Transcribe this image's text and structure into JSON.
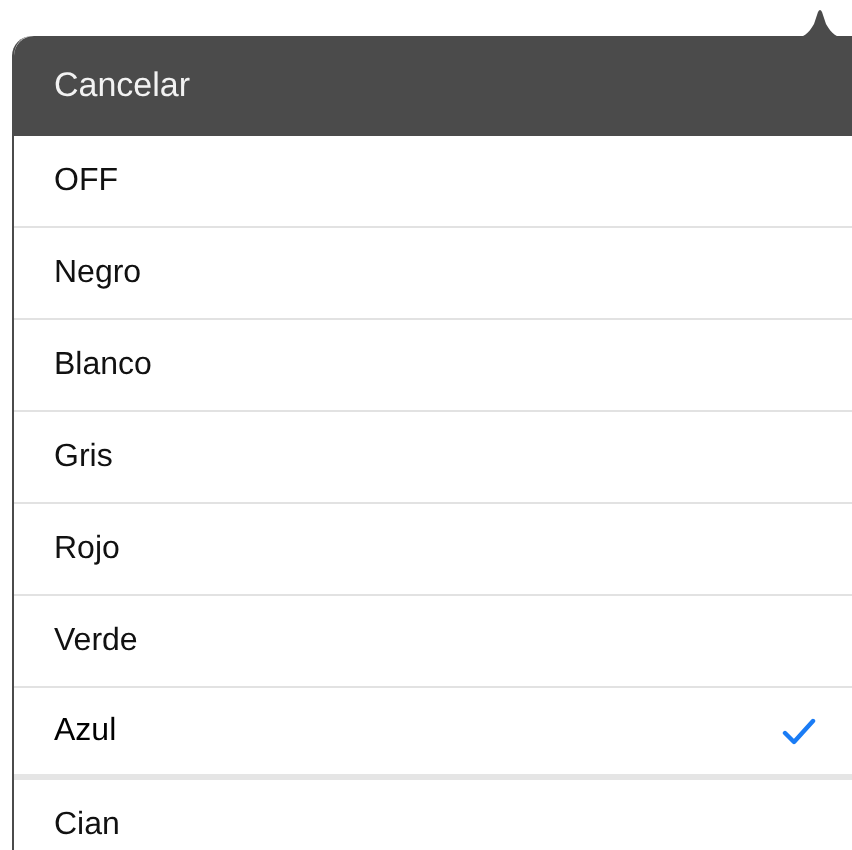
{
  "header": {
    "cancel": "Cancelar"
  },
  "options": [
    {
      "label": "OFF",
      "selected": false
    },
    {
      "label": "Negro",
      "selected": false
    },
    {
      "label": "Blanco",
      "selected": false
    },
    {
      "label": "Gris",
      "selected": false
    },
    {
      "label": "Rojo",
      "selected": false
    },
    {
      "label": "Verde",
      "selected": false
    },
    {
      "label": "Azul",
      "selected": true
    },
    {
      "label": "Cian",
      "selected": false
    }
  ]
}
